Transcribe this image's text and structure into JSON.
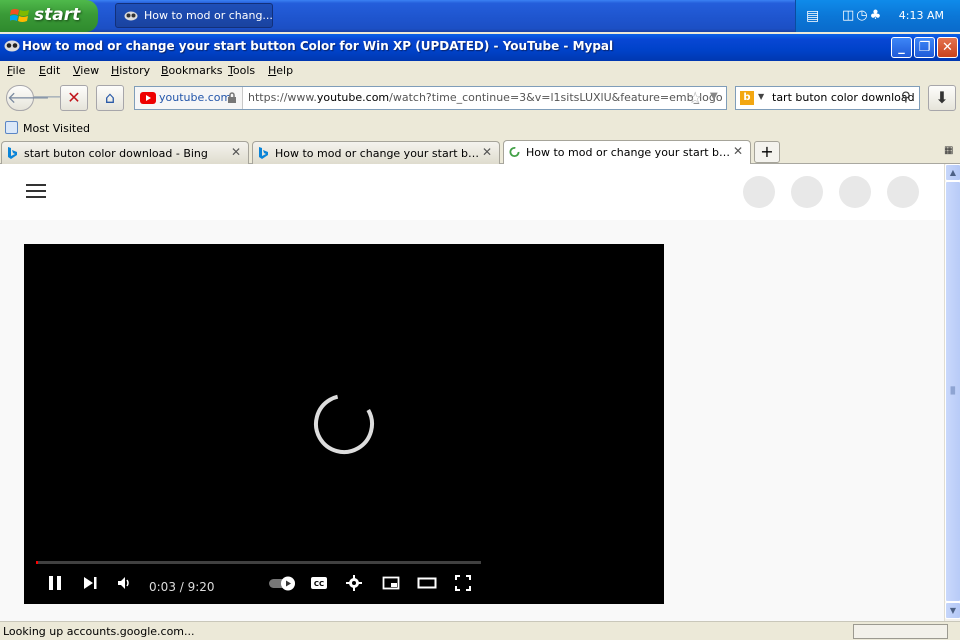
{
  "taskbar": {
    "start_label": "start",
    "task_item": "How to mod or chang...",
    "clock": "4:13 AM"
  },
  "window": {
    "title": "How to mod or change your start button Color for Win XP (UPDATED) - YouTube - Mypal",
    "controls": [
      "minimize",
      "restore",
      "close"
    ]
  },
  "menu": [
    "File",
    "Edit",
    "View",
    "History",
    "Bookmarks",
    "Tools",
    "Help"
  ],
  "navbar": {
    "site_domain": "youtube.com",
    "url_prefix": "https://www.",
    "url_host": "youtube.com",
    "url_path": "/watch?time_continue=3&v=l1sitsLUXlU&feature=emb_logo",
    "search_value": "tart buton color download"
  },
  "bookmarks": {
    "items": [
      "Most Visited"
    ]
  },
  "tabs": [
    {
      "label": "start buton color download - Bing",
      "active": false,
      "icon": "bing-icon"
    },
    {
      "label": "How to mod or change your start button ...",
      "active": false,
      "icon": "bing-icon"
    },
    {
      "label": "How to mod or change your start button ...",
      "active": true,
      "icon": "loading-icon"
    }
  ],
  "player": {
    "time": "0:03 / 9:20",
    "progress_fraction": 0.005
  },
  "status": {
    "text": "Looking up accounts.google.com..."
  },
  "colors": {
    "taskbar_blue": "#245edb",
    "start_green": "#3a9a37",
    "title_blue": "#0042c9",
    "youtube_red": "#ff0000",
    "chrome_beige": "#ece9d8"
  }
}
